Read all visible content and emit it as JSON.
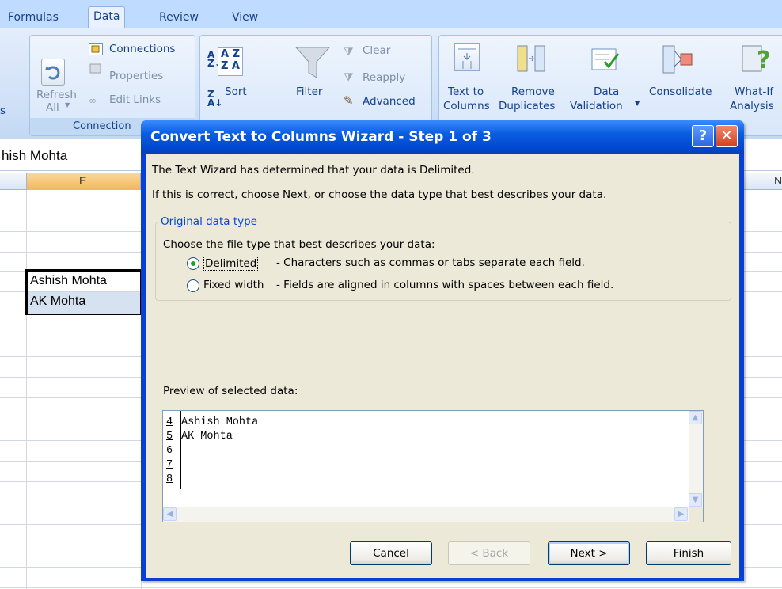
{
  "ribbon": {
    "tabs": [
      "Formulas",
      "Data",
      "Review",
      "View"
    ],
    "active_tab": "Data",
    "connections": {
      "connections_label": "Connections",
      "properties_label": "Properties",
      "edit_links_label": "Edit Links",
      "refresh_label": "Refresh",
      "refresh_all_label": "All",
      "group_label": "Connection",
      "left_fragment": "s"
    },
    "sort_filter": {
      "sort_label": "Sort",
      "filter_label": "Filter",
      "clear_label": "Clear",
      "reapply_label": "Reapply",
      "advanced_label": "Advanced"
    },
    "data_tools": {
      "text_to_label": "Text to",
      "columns_label": "Columns",
      "remove_label": "Remove",
      "duplicates_label": "Duplicates",
      "data_label": "Data",
      "validation_label": "Validation",
      "consolidate_label": "Consolidate",
      "whatif_label": "What-If",
      "analysis_label": "Analysis"
    }
  },
  "sheet": {
    "name_box_fragment": "hish Mohta",
    "column_e": "E",
    "column_n": "N",
    "cells": [
      "Ashish Mohta",
      "AK Mohta"
    ]
  },
  "dialog": {
    "title": "Convert Text to Columns Wizard - Step 1 of 3",
    "help_label": "?",
    "close_label": "✕",
    "line1": "The Text Wizard has determined that your data is Delimited.",
    "line2": "If this is correct, choose Next, or choose the data type that best describes your data.",
    "group_title": "Original data type",
    "choose_label": "Choose the file type that best describes your data:",
    "options": [
      {
        "label": "Delimited",
        "description": "- Characters such as commas or tabs separate each field.",
        "selected": true
      },
      {
        "label": "Fixed width",
        "description": "- Fields are aligned in columns with spaces between each field.",
        "selected": false
      }
    ],
    "preview_label": "Preview of selected data:",
    "preview_rows": [
      {
        "num": "4",
        "text": "Ashish Mohta"
      },
      {
        "num": "5",
        "text": "AK Mohta"
      },
      {
        "num": "6",
        "text": ""
      },
      {
        "num": "7",
        "text": ""
      },
      {
        "num": "8",
        "text": ""
      }
    ],
    "buttons": {
      "cancel": "Cancel",
      "back": "< Back",
      "next": "Next >",
      "finish": "Finish"
    }
  },
  "colors": {
    "ribbon_bg": "#cfe0f7",
    "dialog_title": "#0a5de0",
    "dialog_body": "#ece9d8",
    "close_button": "#e04a2a"
  }
}
